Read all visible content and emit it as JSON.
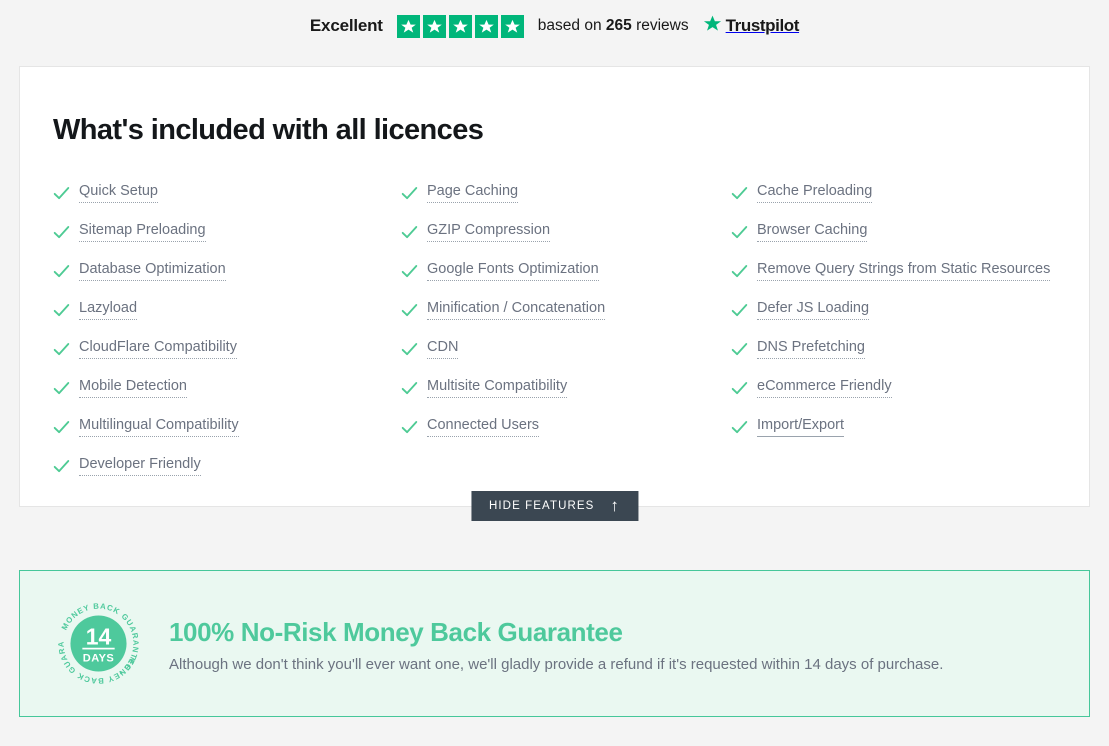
{
  "trustpilot": {
    "rating_label": "Excellent",
    "stars": 5,
    "star_color": "#00b67a",
    "reviews_prefix": "based on",
    "reviews_count": "265",
    "reviews_suffix": "reviews",
    "brand": "Trustpilot",
    "star_icon": "star-icon"
  },
  "features": {
    "title": "What's included with all licences",
    "check_icon": "check-icon",
    "check_color": "#4ecb94",
    "columns": [
      {
        "items": [
          {
            "label": "Quick Setup",
            "underline": "dotted"
          },
          {
            "label": "Sitemap Preloading",
            "underline": "dotted"
          },
          {
            "label": "Database Optimization",
            "underline": "dotted"
          },
          {
            "label": "Lazyload",
            "underline": "dotted"
          },
          {
            "label": "CloudFlare Compatibility",
            "underline": "dotted"
          },
          {
            "label": "Mobile Detection",
            "underline": "dotted"
          },
          {
            "label": "Multilingual Compatibility",
            "underline": "dotted"
          },
          {
            "label": "Developer Friendly",
            "underline": "dotted"
          }
        ]
      },
      {
        "items": [
          {
            "label": "Page Caching",
            "underline": "dotted"
          },
          {
            "label": "GZIP Compression",
            "underline": "dotted"
          },
          {
            "label": "Google Fonts Optimization",
            "underline": "dotted"
          },
          {
            "label": "Minification / Concatenation",
            "underline": "dotted"
          },
          {
            "label": "CDN",
            "underline": "dotted"
          },
          {
            "label": "Multisite Compatibility",
            "underline": "dotted"
          },
          {
            "label": "Connected Users",
            "underline": "dotted"
          }
        ]
      },
      {
        "items": [
          {
            "label": "Cache Preloading",
            "underline": "dotted"
          },
          {
            "label": "Browser Caching",
            "underline": "dotted"
          },
          {
            "label": "Remove Query Strings from Static Resources",
            "underline": "dotted"
          },
          {
            "label": "Defer JS Loading",
            "underline": "dotted"
          },
          {
            "label": "DNS Prefetching",
            "underline": "dotted"
          },
          {
            "label": "eCommerce Friendly",
            "underline": "dotted"
          },
          {
            "label": "Import/Export",
            "underline": "solid"
          }
        ]
      }
    ],
    "hide_button": {
      "label": "Hide features",
      "icon": "arrow-up-icon",
      "arrow": "↑",
      "background": "#3b4752"
    }
  },
  "guarantee": {
    "badge": {
      "days_number": "14",
      "days_word": "DAYS",
      "ring_text": "MONEY BACK GUARANTEE •",
      "color": "#4ec99c"
    },
    "title": "100% No-Risk Money Back Guarantee",
    "description": "Although we don't think you'll ever want one, we'll gladly provide a refund if it's requested within 14 days of purchase.",
    "accent_color": "#4ec99c",
    "background": "#eaf8f1"
  }
}
